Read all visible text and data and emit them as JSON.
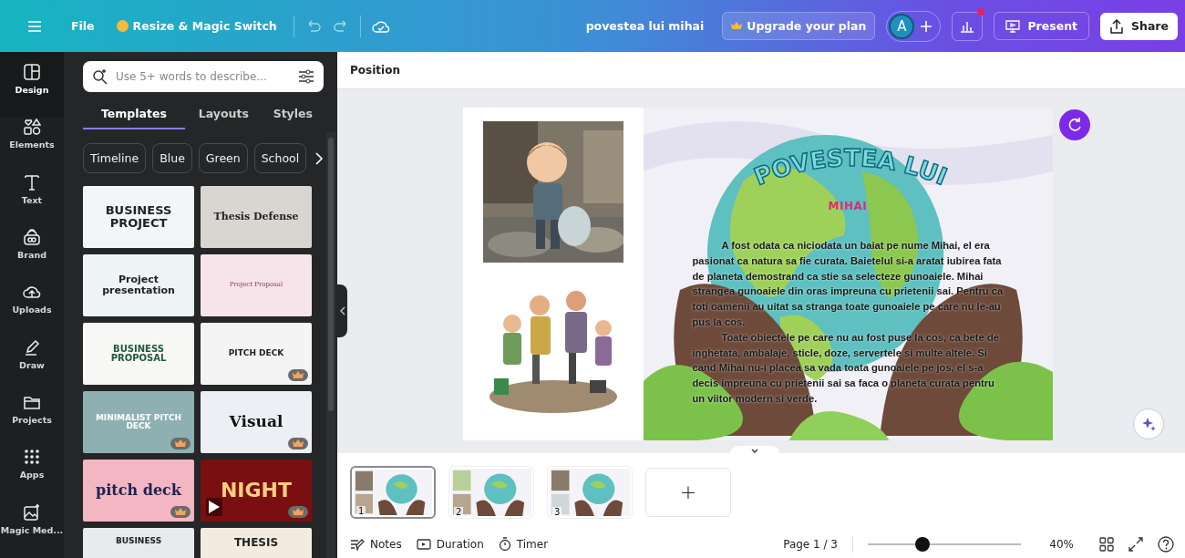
{
  "topbar": {
    "file": "File",
    "resize": "Resize & Magic Switch",
    "doc_title": "povestea lui mihai",
    "upgrade": "Upgrade your plan",
    "avatar": "A",
    "present": "Present",
    "share": "Share"
  },
  "rail": [
    {
      "label": "Design",
      "selected": true
    },
    {
      "label": "Elements",
      "selected": false
    },
    {
      "label": "Text",
      "selected": false
    },
    {
      "label": "Brand",
      "selected": false
    },
    {
      "label": "Uploads",
      "selected": false
    },
    {
      "label": "Draw",
      "selected": false
    },
    {
      "label": "Projects",
      "selected": false
    },
    {
      "label": "Apps",
      "selected": false
    },
    {
      "label": "Magic Med...",
      "selected": false
    }
  ],
  "panel": {
    "search": {
      "placeholder": "Use 5+ words to describe..."
    },
    "tabs": [
      {
        "label": "Templates",
        "selected": true
      },
      {
        "label": "Layouts",
        "selected": false
      },
      {
        "label": "Styles",
        "selected": false
      }
    ],
    "chips": [
      "Timeline",
      "Blue",
      "Green",
      "School"
    ],
    "templates": [
      {
        "title": "BUSINESS PROJECT",
        "premium": false,
        "video": false
      },
      {
        "title": "Thesis Defense",
        "premium": false,
        "video": false
      },
      {
        "title": "Project presentation",
        "premium": false,
        "video": false
      },
      {
        "title": "Project Proposal",
        "premium": false,
        "video": false
      },
      {
        "title": "BUSINESS PROPOSAL",
        "premium": false,
        "video": false
      },
      {
        "title": "PITCH DECK",
        "premium": true,
        "video": false
      },
      {
        "title": "MINIMALIST PITCH DECK",
        "premium": true,
        "video": false
      },
      {
        "title": "Visual",
        "premium": true,
        "video": false
      },
      {
        "title": "pitch deck",
        "premium": true,
        "video": false
      },
      {
        "title": "NIGHT",
        "premium": true,
        "video": true
      },
      {
        "title": "BUSINESS"
      },
      {
        "title": "THESIS"
      }
    ]
  },
  "toolbar": {
    "position": "Position"
  },
  "slide": {
    "title": "POVESTEA LUI",
    "subtitle": "MIHAI",
    "paragraphs": [
      "A fost odata ca niciodata un baiat pe nume Mihai, el era pasionat ca natura sa fie curata. Baietelul si-a aratat iubirea fata de planeta demostrand ca stie sa selecteze gunoaiele. Mihai strangea gunoaiele din oras impreuna cu prietenii sai. Pentru ca toti oamenii au uitat sa stranga toate gunoaiele pe care nu le-au pus la cos.",
      "Toate obiectele pe care nu au fost puse la cos, ca bete de inghetata, ambalaje, sticle, doze, servertele si multe altele. Si cand Mihai nu-i placea sa vada toata gunoaiele pe jos, el s-a decis impreuna cu prietenii sai sa faca o planeta curata pentru un viitor modern si verde."
    ]
  },
  "pages": [
    {
      "number": "1",
      "selected": true
    },
    {
      "number": "2",
      "selected": false
    },
    {
      "number": "3",
      "selected": false
    }
  ],
  "add_page": "+",
  "footer": {
    "notes": "Notes",
    "duration": "Duration",
    "timer": "Timer",
    "page": "Page 1 / 3",
    "zoom": {
      "level": 0.36
    },
    "zoom_reading": "40%"
  }
}
